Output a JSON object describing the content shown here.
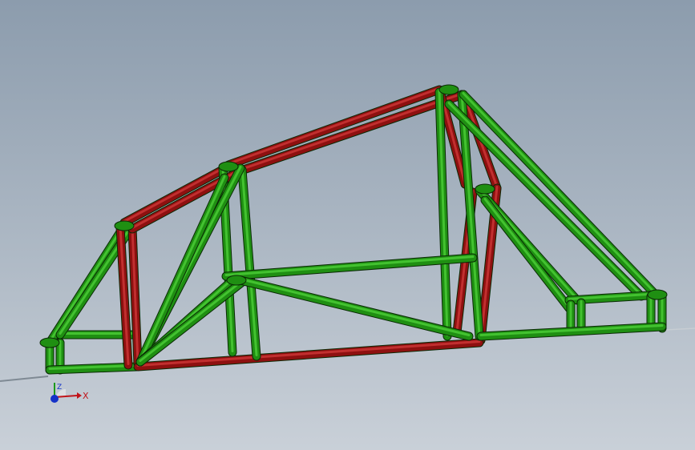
{
  "viewport": {
    "background_top": "#8c9cad",
    "background_bottom": "#c9d0d8"
  },
  "colors": {
    "tube_green": "#1f8f12",
    "tube_green_highlight": "#4fd43a",
    "tube_red": "#8e1010",
    "tube_red_highlight": "#d23a3a",
    "edge": "#0a2a05"
  },
  "triad": {
    "x_label": "X",
    "z_label": "Z",
    "icon": "coordinate-triad-icon"
  }
}
